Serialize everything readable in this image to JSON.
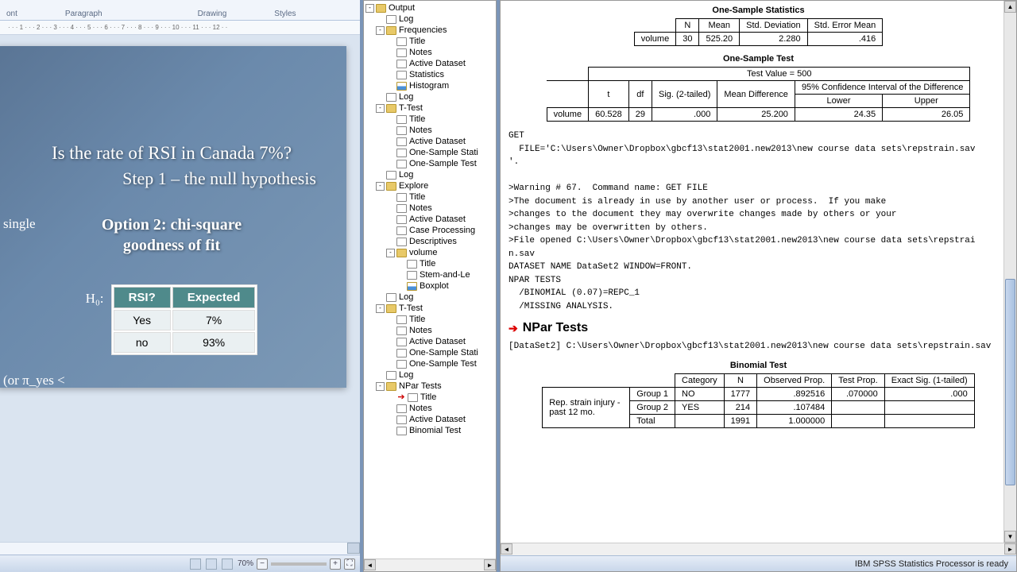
{
  "word": {
    "ribbon_groups": {
      "font": "ont",
      "paragraph": "Paragraph",
      "drawing": "Drawing",
      "styles": "Styles"
    },
    "ruler_text": "· · · 1 · · · 2 · · · 3 · · · 4 · · · 5 · · · 6 · · · 7 · · · 8 · · · 9 · · · 10 · · · 11 · · · 12 · ·",
    "slide": {
      "title": "Is the rate of RSI in Canada 7%?",
      "subtitle": "Step 1 – the null hypothesis",
      "option_line1": "Option 2: chi-square",
      "option_line2": "goodness of fit",
      "side_text": "single",
      "h0": "H₀:",
      "bottom_left": "(or π_yes <",
      "table": {
        "headers": [
          "RSI?",
          "Expected"
        ],
        "rows": [
          [
            "Yes",
            "7%"
          ],
          [
            "no",
            "93%"
          ]
        ]
      }
    },
    "zoom": "70%"
  },
  "tree": [
    {
      "indent": 0,
      "toggle": "-",
      "icon": "folder",
      "text": "Output"
    },
    {
      "indent": 1,
      "toggle": "",
      "icon": "page",
      "text": "Log"
    },
    {
      "indent": 1,
      "toggle": "-",
      "icon": "folder",
      "text": "Frequencies"
    },
    {
      "indent": 2,
      "toggle": "",
      "icon": "page",
      "text": "Title"
    },
    {
      "indent": 2,
      "toggle": "",
      "icon": "page",
      "text": "Notes"
    },
    {
      "indent": 2,
      "toggle": "",
      "icon": "page",
      "text": "Active Dataset"
    },
    {
      "indent": 2,
      "toggle": "",
      "icon": "page",
      "text": "Statistics"
    },
    {
      "indent": 2,
      "toggle": "",
      "icon": "chart",
      "text": "Histogram"
    },
    {
      "indent": 1,
      "toggle": "",
      "icon": "page",
      "text": "Log"
    },
    {
      "indent": 1,
      "toggle": "-",
      "icon": "folder",
      "text": "T-Test"
    },
    {
      "indent": 2,
      "toggle": "",
      "icon": "page",
      "text": "Title"
    },
    {
      "indent": 2,
      "toggle": "",
      "icon": "page",
      "text": "Notes"
    },
    {
      "indent": 2,
      "toggle": "",
      "icon": "page",
      "text": "Active Dataset"
    },
    {
      "indent": 2,
      "toggle": "",
      "icon": "page",
      "text": "One-Sample Stati"
    },
    {
      "indent": 2,
      "toggle": "",
      "icon": "page",
      "text": "One-Sample Test"
    },
    {
      "indent": 1,
      "toggle": "",
      "icon": "page",
      "text": "Log"
    },
    {
      "indent": 1,
      "toggle": "-",
      "icon": "folder",
      "text": "Explore"
    },
    {
      "indent": 2,
      "toggle": "",
      "icon": "page",
      "text": "Title"
    },
    {
      "indent": 2,
      "toggle": "",
      "icon": "page",
      "text": "Notes"
    },
    {
      "indent": 2,
      "toggle": "",
      "icon": "page",
      "text": "Active Dataset"
    },
    {
      "indent": 2,
      "toggle": "",
      "icon": "page",
      "text": "Case Processing"
    },
    {
      "indent": 2,
      "toggle": "",
      "icon": "page",
      "text": "Descriptives"
    },
    {
      "indent": 2,
      "toggle": "-",
      "icon": "folder",
      "text": "volume"
    },
    {
      "indent": 3,
      "toggle": "",
      "icon": "page",
      "text": "Title"
    },
    {
      "indent": 3,
      "toggle": "",
      "icon": "page",
      "text": "Stem-and-Le"
    },
    {
      "indent": 3,
      "toggle": "",
      "icon": "chart",
      "text": "Boxplot"
    },
    {
      "indent": 1,
      "toggle": "",
      "icon": "page",
      "text": "Log"
    },
    {
      "indent": 1,
      "toggle": "-",
      "icon": "folder",
      "text": "T-Test"
    },
    {
      "indent": 2,
      "toggle": "",
      "icon": "page",
      "text": "Title"
    },
    {
      "indent": 2,
      "toggle": "",
      "icon": "page",
      "text": "Notes"
    },
    {
      "indent": 2,
      "toggle": "",
      "icon": "page",
      "text": "Active Dataset"
    },
    {
      "indent": 2,
      "toggle": "",
      "icon": "page",
      "text": "One-Sample Stati"
    },
    {
      "indent": 2,
      "toggle": "",
      "icon": "page",
      "text": "One-Sample Test"
    },
    {
      "indent": 1,
      "toggle": "",
      "icon": "page",
      "text": "Log"
    },
    {
      "indent": 1,
      "toggle": "-",
      "icon": "folder",
      "text": "NPar Tests"
    },
    {
      "indent": 2,
      "toggle": "",
      "icon": "page",
      "text": "Title",
      "arrow": true
    },
    {
      "indent": 2,
      "toggle": "",
      "icon": "page",
      "text": "Notes"
    },
    {
      "indent": 2,
      "toggle": "",
      "icon": "page",
      "text": "Active Dataset"
    },
    {
      "indent": 2,
      "toggle": "",
      "icon": "page",
      "text": "Binomial Test"
    }
  ],
  "output": {
    "stats_caption": "One-Sample Statistics",
    "stats": {
      "headers": [
        "",
        "N",
        "Mean",
        "Std. Deviation",
        "Std. Error Mean"
      ],
      "row": [
        "volume",
        "30",
        "525.20",
        "2.280",
        ".416"
      ]
    },
    "test_caption": "One-Sample Test",
    "test_value": "Test Value = 500",
    "test": {
      "ci_header": "95% Confidence Interval of the Difference",
      "headers": [
        "",
        "t",
        "df",
        "Sig. (2-tailed)",
        "Mean Difference",
        "Lower",
        "Upper"
      ],
      "row": [
        "volume",
        "60.528",
        "29",
        ".000",
        "25.200",
        "24.35",
        "26.05"
      ]
    },
    "syntax": "GET\n  FILE='C:\\Users\\Owner\\Dropbox\\gbcf13\\stat2001.new2013\\new course data sets\\repstrain.sav\n'.\n\n>Warning # 67.  Command name: GET FILE\n>The document is already in use by another user or process.  If you make\n>changes to the document they may overwrite changes made by others or your\n>changes may be overwritten by others.\n>File opened C:\\Users\\Owner\\Dropbox\\gbcf13\\stat2001.new2013\\new course data sets\\repstrai\nn.sav\nDATASET NAME DataSet2 WINDOW=FRONT.\nNPAR TESTS\n  /BINOMIAL (0.07)=REPC_1\n  /MISSING ANALYSIS.",
    "npar_header": "NPar Tests",
    "dataset_line": "[DataSet2] C:\\Users\\Owner\\Dropbox\\gbcf13\\stat2001.new2013\\new course data sets\\repstrain.sav",
    "binomial_caption": "Binomial Test",
    "binomial": {
      "headers": [
        "",
        "",
        "Category",
        "N",
        "Observed Prop.",
        "Test Prop.",
        "Exact Sig. (1-tailed)"
      ],
      "rows": [
        [
          "Rep. strain injury - past 12 mo.",
          "Group 1",
          "NO",
          "1777",
          ".892516",
          ".070000",
          ".000"
        ],
        [
          "",
          "Group 2",
          "YES",
          "214",
          ".107484",
          "",
          ""
        ],
        [
          "",
          "Total",
          "",
          "1991",
          "1.000000",
          "",
          ""
        ]
      ]
    }
  },
  "status": "IBM SPSS Statistics Processor is ready"
}
